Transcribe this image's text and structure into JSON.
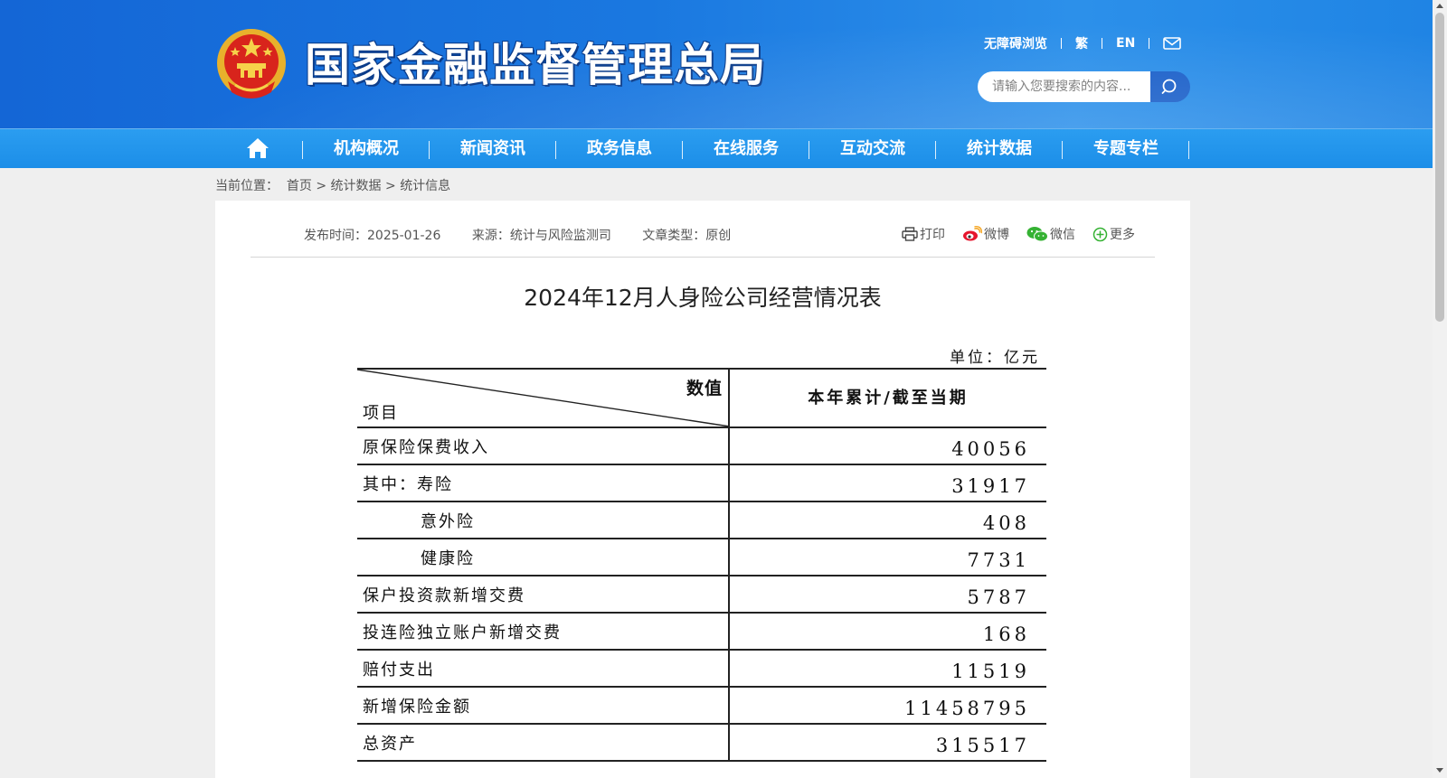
{
  "header": {
    "site_title": "国家金融监督管理总局",
    "top_links": [
      "无障碍浏览",
      "繁",
      "EN"
    ],
    "mail_icon": "mail-icon",
    "search": {
      "placeholder": "请输入您要搜索的内容...",
      "icon": "search-icon"
    }
  },
  "nav": {
    "home_icon": "home-icon",
    "items": [
      "机构概况",
      "新闻资讯",
      "政务信息",
      "在线服务",
      "互动交流",
      "统计数据",
      "专题专栏"
    ]
  },
  "breadcrumb": {
    "prefix": "当前位置：",
    "items": [
      "首页",
      "统计数据",
      "统计信息"
    ],
    "separator": ">"
  },
  "article": {
    "meta": {
      "publish_time": "发布时间：2025-01-26",
      "source": "来源：统计与风险监测司",
      "type": "文章类型：原创"
    },
    "share": [
      {
        "label": "打印",
        "icon": "print-icon"
      },
      {
        "label": "微博",
        "icon": "weibo-icon"
      },
      {
        "label": "微信",
        "icon": "wechat-icon"
      },
      {
        "label": "更多",
        "icon": "more-icon"
      }
    ],
    "title": "2024年12月人身险公司经营情况表"
  },
  "table": {
    "unit": "单位：亿元",
    "header": {
      "diag_top": "数值",
      "diag_bottom": "项目",
      "column": "本年累计/截至当期"
    },
    "rows": [
      {
        "item": "原保险保费收入",
        "value": "40056",
        "indent": false
      },
      {
        "item": "其中：寿险",
        "value": "31917",
        "indent": false
      },
      {
        "item": "意外险",
        "value": "408",
        "indent": true
      },
      {
        "item": "健康险",
        "value": "7731",
        "indent": true
      },
      {
        "item": "保户投资款新增交费",
        "value": "5787",
        "indent": false
      },
      {
        "item": "投连险独立账户新增交费",
        "value": "168",
        "indent": false
      },
      {
        "item": "赔付支出",
        "value": "11519",
        "indent": false
      },
      {
        "item": "新增保险金额",
        "value": "11458795",
        "indent": false
      },
      {
        "item": "总资产",
        "value": "315517",
        "indent": false
      }
    ]
  },
  "colors": {
    "header_blue": "#1a78e0",
    "nav_blue": "#1c8ee8",
    "search_button": "#1a5fc9"
  }
}
